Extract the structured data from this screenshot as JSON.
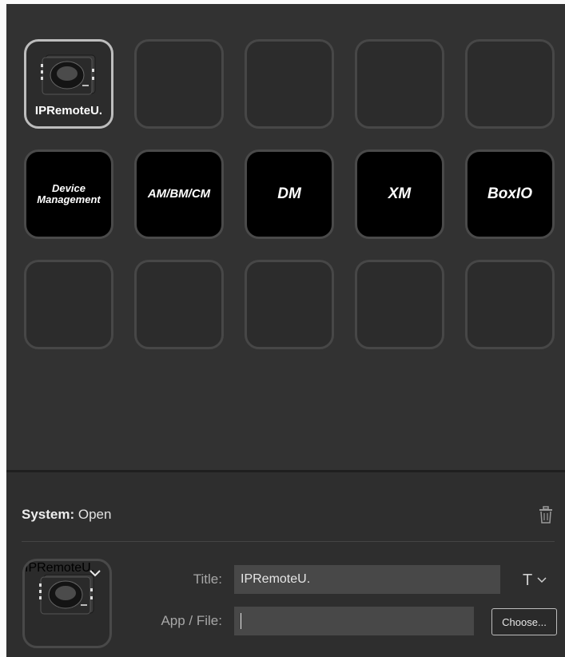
{
  "keys": {
    "row1": [
      {
        "caption": "IPRemoteU.",
        "icon": "device-camera-icon"
      },
      {},
      {},
      {},
      {}
    ],
    "row2": [
      {
        "label": "Device Management"
      },
      {
        "label": "AM/BM/CM"
      },
      {
        "label": "DM"
      },
      {
        "label": "XM"
      },
      {
        "label": "BoxIO"
      }
    ],
    "row3": [
      {},
      {},
      {},
      {},
      {}
    ]
  },
  "properties": {
    "action_category": "System:",
    "action_name": "Open",
    "delete_icon": "trash-icon",
    "preview_caption": "IPRemoteU.",
    "title_label": "Title:",
    "title_value": "IPRemoteU.",
    "app_file_label": "App / File:",
    "app_file_value": "",
    "font_button": "T",
    "choose_button": "Choose..."
  },
  "colors": {
    "key_border_selected": "#bdbdbd",
    "key_black": "#000000",
    "panel_bg": "#2e2e2e"
  }
}
